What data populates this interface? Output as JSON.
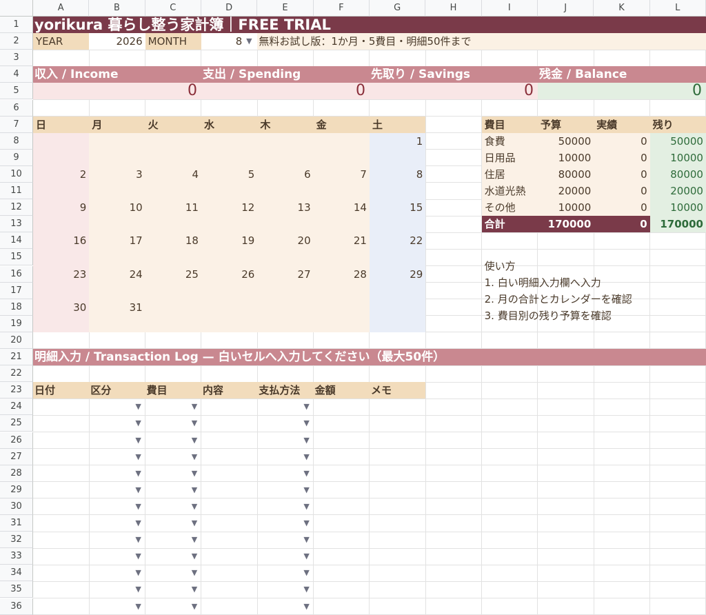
{
  "columns": [
    "A",
    "B",
    "C",
    "D",
    "E",
    "F",
    "G",
    "H",
    "I",
    "J",
    "K",
    "L"
  ],
  "rows": [
    "1",
    "2",
    "3",
    "4",
    "5",
    "6",
    "7",
    "8",
    "9",
    "10",
    "11",
    "12",
    "13",
    "14",
    "15",
    "16",
    "17",
    "18",
    "19",
    "20",
    "21",
    "22",
    "23",
    "24",
    "25",
    "26",
    "27",
    "28",
    "29",
    "30",
    "31",
    "32",
    "33",
    "34",
    "35",
    "36"
  ],
  "title": "yorikura 暮らし整う家計簿｜FREE TRIAL",
  "settings": {
    "year_label": "YEAR",
    "year_value": "2026",
    "month_label": "MONTH",
    "month_value": "8",
    "trial_note": "無料お試し版：1か月・5費目・明細50件まで"
  },
  "summary": [
    {
      "label": "収入 / Income",
      "value": "0"
    },
    {
      "label": "支出 / Spending",
      "value": "0"
    },
    {
      "label": "先取り / Savings",
      "value": "0"
    },
    {
      "label": "残金 / Balance",
      "value": "0"
    }
  ],
  "calendar": {
    "weekdays": [
      "日",
      "月",
      "火",
      "水",
      "木",
      "金",
      "土"
    ],
    "weeks": [
      [
        "",
        "",
        "",
        "",
        "",
        "",
        "1"
      ],
      [
        "2",
        "3",
        "4",
        "5",
        "6",
        "7",
        "8"
      ],
      [
        "9",
        "10",
        "11",
        "12",
        "13",
        "14",
        "15"
      ],
      [
        "16",
        "17",
        "18",
        "19",
        "20",
        "21",
        "22"
      ],
      [
        "23",
        "24",
        "25",
        "26",
        "27",
        "28",
        "29"
      ],
      [
        "30",
        "31",
        "",
        "",
        "",
        "",
        ""
      ]
    ]
  },
  "budget": {
    "headers": [
      "費目",
      "予算",
      "実績",
      "残り"
    ],
    "rows": [
      [
        "食費",
        "50000",
        "0",
        "50000"
      ],
      [
        "日用品",
        "10000",
        "0",
        "10000"
      ],
      [
        "住居",
        "80000",
        "0",
        "80000"
      ],
      [
        "水道光熱",
        "20000",
        "0",
        "20000"
      ],
      [
        "その他",
        "10000",
        "0",
        "10000"
      ]
    ],
    "total": [
      "合計",
      "170000",
      "0",
      "170000"
    ]
  },
  "howto": {
    "title": "使い方",
    "steps": [
      "1. 白い明細入力欄へ入力",
      "2. 月の合計とカレンダーを確認",
      "3. 費目別の残り予算を確認"
    ]
  },
  "log": {
    "title": "明細入力 / Transaction Log — 白いセルへ入力してください（最大50件）",
    "headers": [
      "日付",
      "区分",
      "費目",
      "内容",
      "支払方法",
      "金額",
      "メモ"
    ],
    "dropdown_icon": "▼"
  },
  "colors": {
    "title_band": "#7a3a49",
    "summary_band": "#c98890",
    "summary_value_bg": "#f9e6e6",
    "balance_value_bg": "#e3efe2",
    "header_beige": "#f2dcbc",
    "setting_bg": "#fbf1e4",
    "calendar_body": "#fbf1e6",
    "calendar_sunday": "#f9e8e8",
    "calendar_saturday": "#e9eef8",
    "budget_body": "#fbf1e6",
    "budget_remaining": "#e3efe2",
    "total_band": "#7a3a49"
  }
}
